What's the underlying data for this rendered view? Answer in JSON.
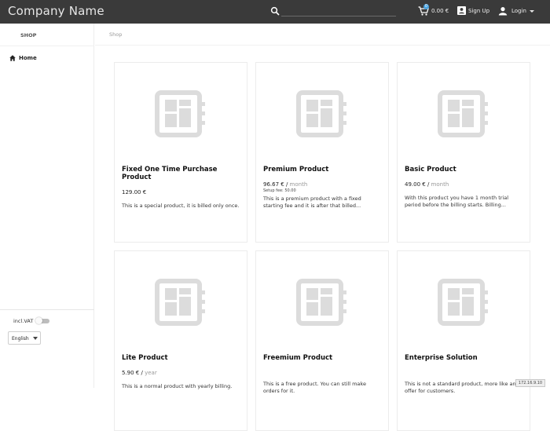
{
  "header": {
    "brand": "Company Name",
    "cart_total": "0.00 €",
    "cart_count": "0",
    "signup_label": "Sign Up",
    "login_label": "Login"
  },
  "sidebar": {
    "header": "SHOP",
    "items": [
      {
        "label": "Home",
        "icon": "home-icon"
      }
    ],
    "vat_label": "incl.VAT",
    "vat_enabled": false,
    "language": "English"
  },
  "breadcrumb": "Shop",
  "products": [
    {
      "title": "Fixed One Time Purchase Product",
      "price": "129.00 €",
      "period": "",
      "setup": "",
      "description": "This is a special product, it is billed only once."
    },
    {
      "title": "Premium Product",
      "price": "96.67 € /",
      "period": "month",
      "setup": "Setup fee: 50.00",
      "description": "This is a premium product with a fixed starting fee and it is after that billed..."
    },
    {
      "title": "Basic Product",
      "price": "49.00 € /",
      "period": "month",
      "setup": "",
      "description": "With this product you have 1 month trial period before the billing starts. Billing..."
    },
    {
      "title": "Lite Product",
      "price": "5.90 € /",
      "period": "year",
      "setup": "",
      "description": "This is a normal product with yearly billing."
    },
    {
      "title": "Freemium Product",
      "price": "",
      "period": "",
      "setup": "",
      "description": "This is a free product. You can still make orders for it."
    },
    {
      "title": "Enterprise Solution",
      "price": "",
      "period": "",
      "setup": "",
      "description": "This is not a standard product, more like an offer for customers."
    }
  ],
  "ip_badge": "172.16.9.10",
  "colors": {
    "topbar": "#3a3a3a",
    "accent": "#4aa3e0",
    "placeholder": "#dcdcdc"
  }
}
